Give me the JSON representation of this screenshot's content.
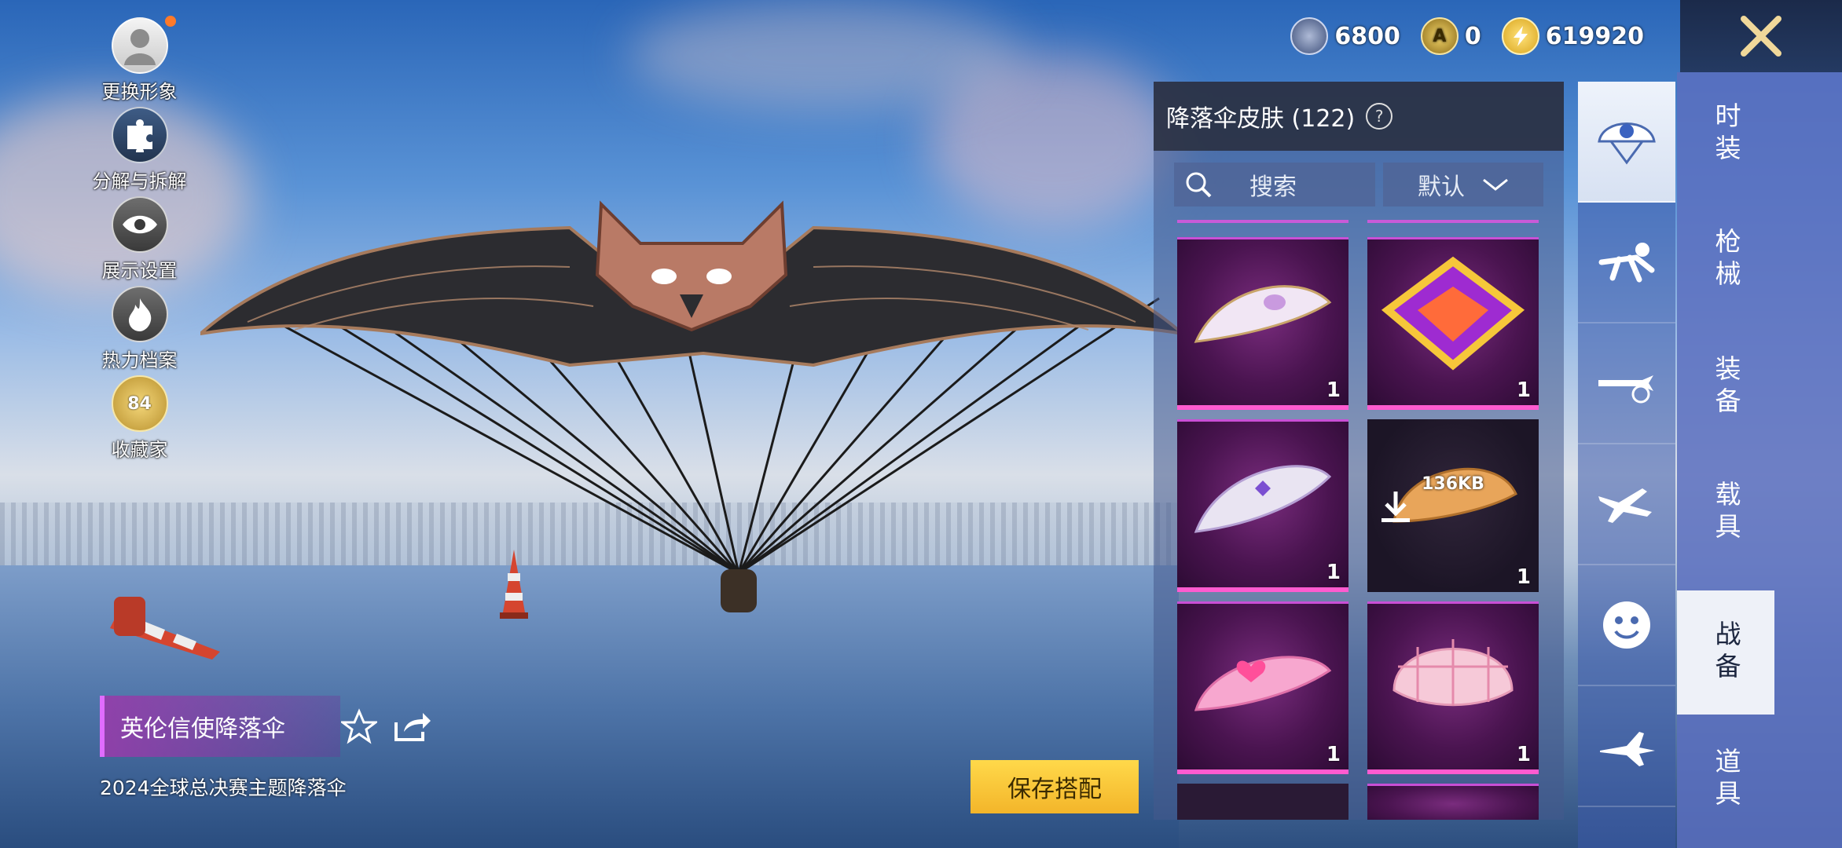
{
  "left_menu": [
    {
      "label": "更换形象",
      "icon": "avatar-icon"
    },
    {
      "label": "分解与拆解",
      "icon": "puzzle-icon"
    },
    {
      "label": "展示设置",
      "icon": "eye-icon"
    },
    {
      "label": "热力档案",
      "icon": "flame-icon"
    },
    {
      "label": "收藏家",
      "icon": "collector-badge-icon",
      "badge_level": "84"
    }
  ],
  "currencies": [
    {
      "value": "6800",
      "icon": "silver-coin-icon",
      "color": "#8fa3c8"
    },
    {
      "value": "0",
      "icon": "ag-coin-icon",
      "color": "#caa84a"
    },
    {
      "value": "619920",
      "icon": "bp-coin-icon",
      "color": "#f2c94c"
    }
  ],
  "item": {
    "name": "英伦信使降落伞",
    "description": "2024全球总决赛主题降落伞"
  },
  "buttons": {
    "save": "保存搭配"
  },
  "panel": {
    "title": "降落伞皮肤 (122)",
    "search_label": "搜索",
    "sort_label": "默认"
  },
  "cards": [
    {
      "count": "1",
      "style": "white-gold-wing"
    },
    {
      "count": "1",
      "style": "gold-purple-diamond"
    },
    {
      "count": "1",
      "style": "silver-purple-wing"
    },
    {
      "count": "1",
      "style": "orange-not-downloaded",
      "download_size": "136KB"
    },
    {
      "count": "1",
      "style": "pink-heart"
    },
    {
      "count": "1",
      "style": "pink-plaid-dome"
    }
  ],
  "mid_tabs": [
    {
      "icon": "parachute-icon",
      "active": true
    },
    {
      "icon": "skydiver-icon",
      "active": false
    },
    {
      "icon": "plane-trail-icon",
      "active": false
    },
    {
      "icon": "airplane-icon",
      "active": false
    },
    {
      "icon": "smiley-emote-icon",
      "active": false
    },
    {
      "icon": "fighter-jet-icon",
      "active": false
    }
  ],
  "categories": [
    {
      "label": "时装",
      "active": false
    },
    {
      "label": "枪械",
      "active": false
    },
    {
      "label": "装备",
      "active": false
    },
    {
      "label": "载具",
      "active": false
    },
    {
      "label": "战备",
      "active": true
    },
    {
      "label": "道具",
      "active": false
    }
  ],
  "colors": {
    "accent": "#ff5bd0",
    "save_button": "#ffd94a",
    "active_tab": "#eef1f8"
  }
}
